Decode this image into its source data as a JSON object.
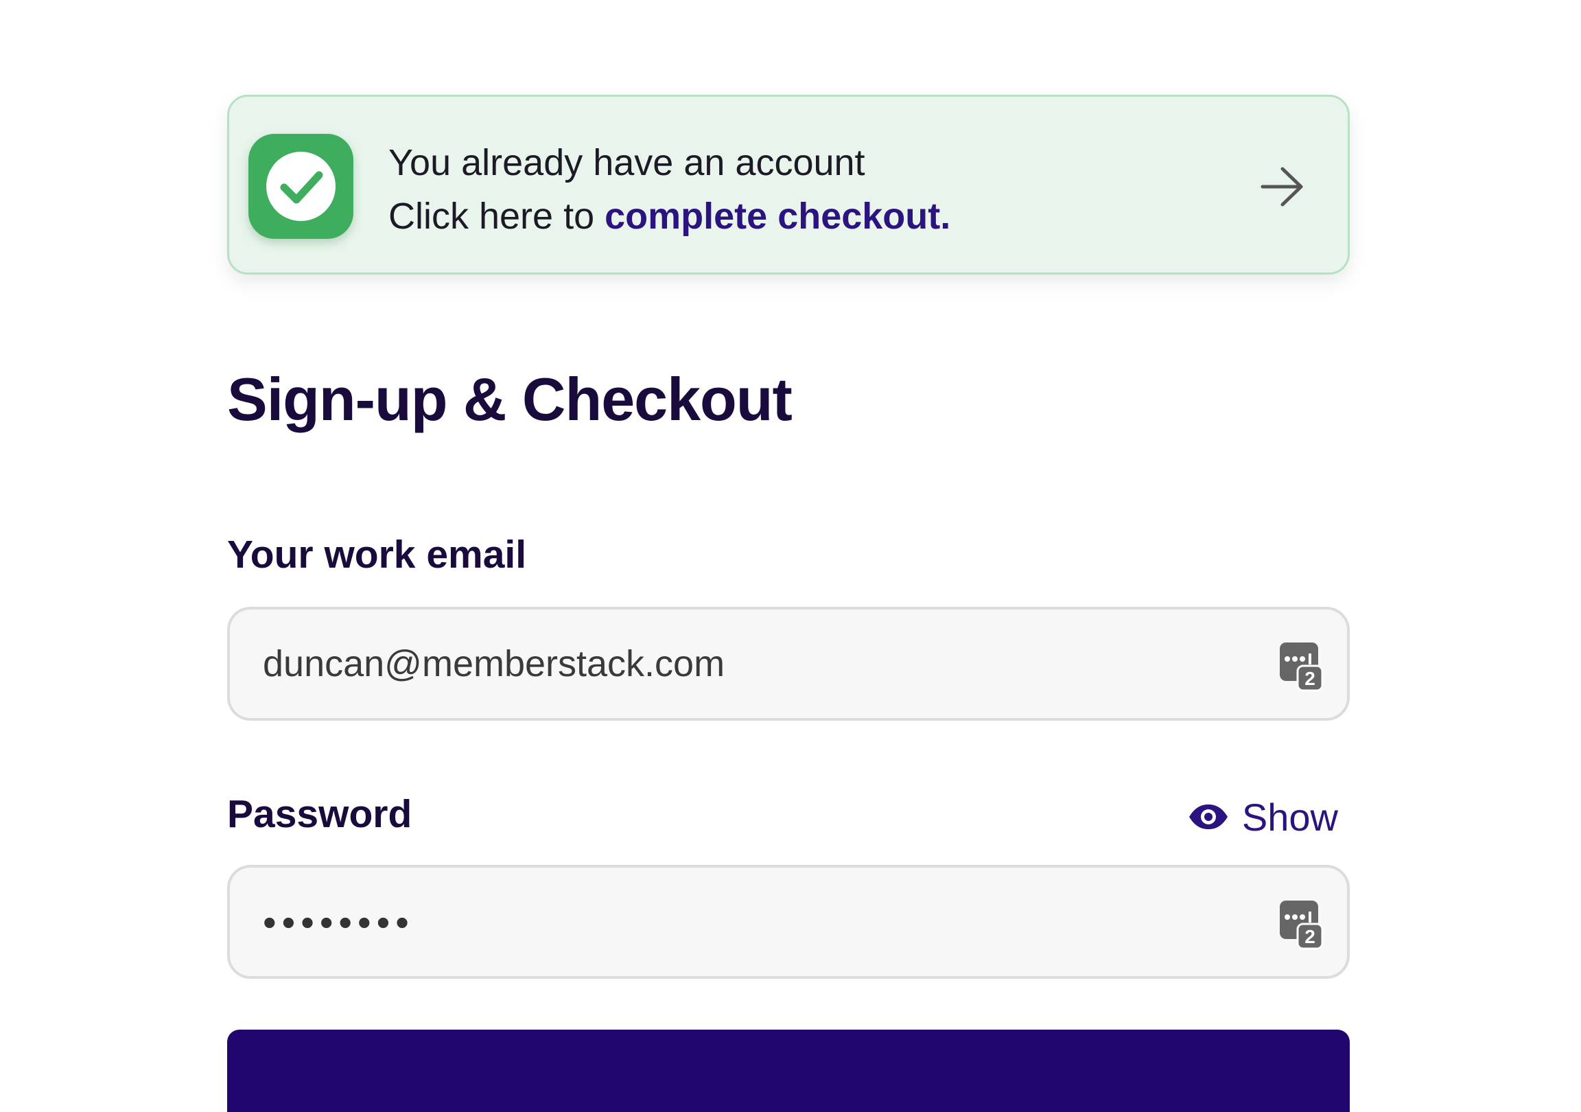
{
  "banner": {
    "line1": "You already have an account",
    "line2_prefix": "Click here to ",
    "line2_link": "complete checkout.",
    "icon": "check-circle-icon",
    "arrow_icon": "arrow-right-icon",
    "colors": {
      "background": "#e9f5ec",
      "icon": "#3ead5d",
      "link": "#2c1480"
    }
  },
  "page": {
    "title": "Sign-up & Checkout"
  },
  "form": {
    "email": {
      "label": "Your work email",
      "value": "duncan@memberstack.com",
      "manager_icon": "password-manager-icon"
    },
    "password": {
      "label": "Password",
      "value": "••••••••",
      "toggle_label": "Show",
      "toggle_icon": "eye-icon",
      "manager_icon": "password-manager-icon"
    },
    "submit": {
      "color": "#21066f"
    }
  }
}
